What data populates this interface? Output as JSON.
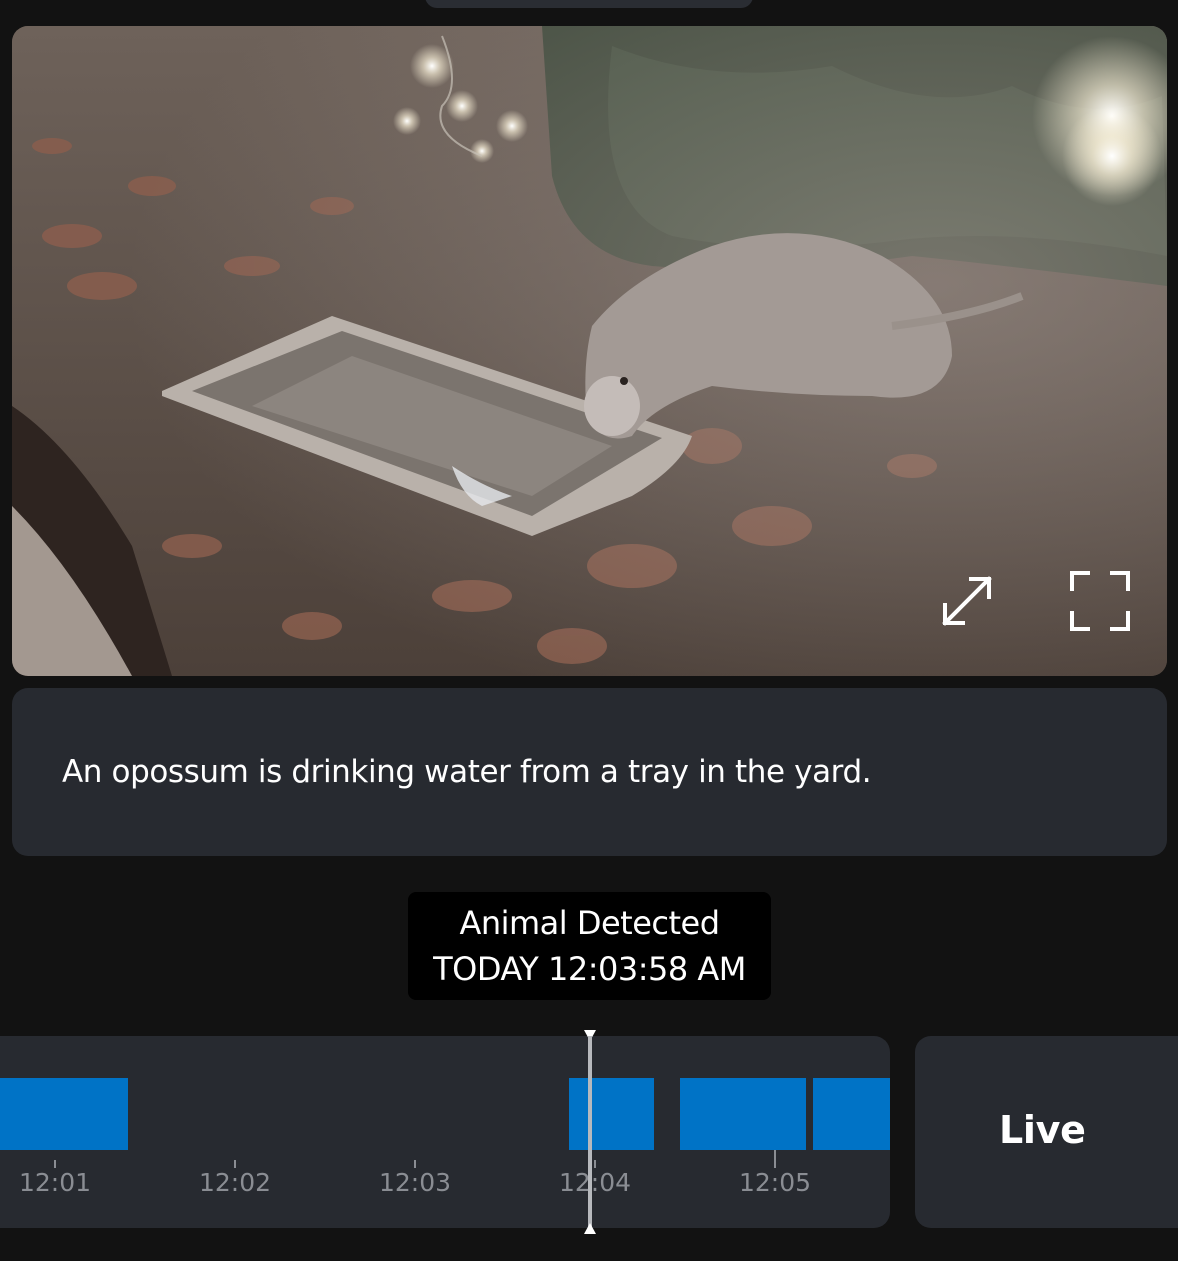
{
  "video": {
    "expand_icon": "diagonal-expand-icon",
    "fullscreen_icon": "fullscreen-corners-icon"
  },
  "caption": {
    "text": "An opossum is drinking water from a tray in the yard."
  },
  "event": {
    "type": "Animal Detected",
    "time": "TODAY 12:03:58 AM"
  },
  "timeline": {
    "ticks": [
      "12:01",
      "12:02",
      "12:03",
      "12:04",
      "12:05"
    ],
    "accent": "#0073c6",
    "playhead_time": "12:03:58"
  },
  "live": {
    "label": "Live"
  }
}
